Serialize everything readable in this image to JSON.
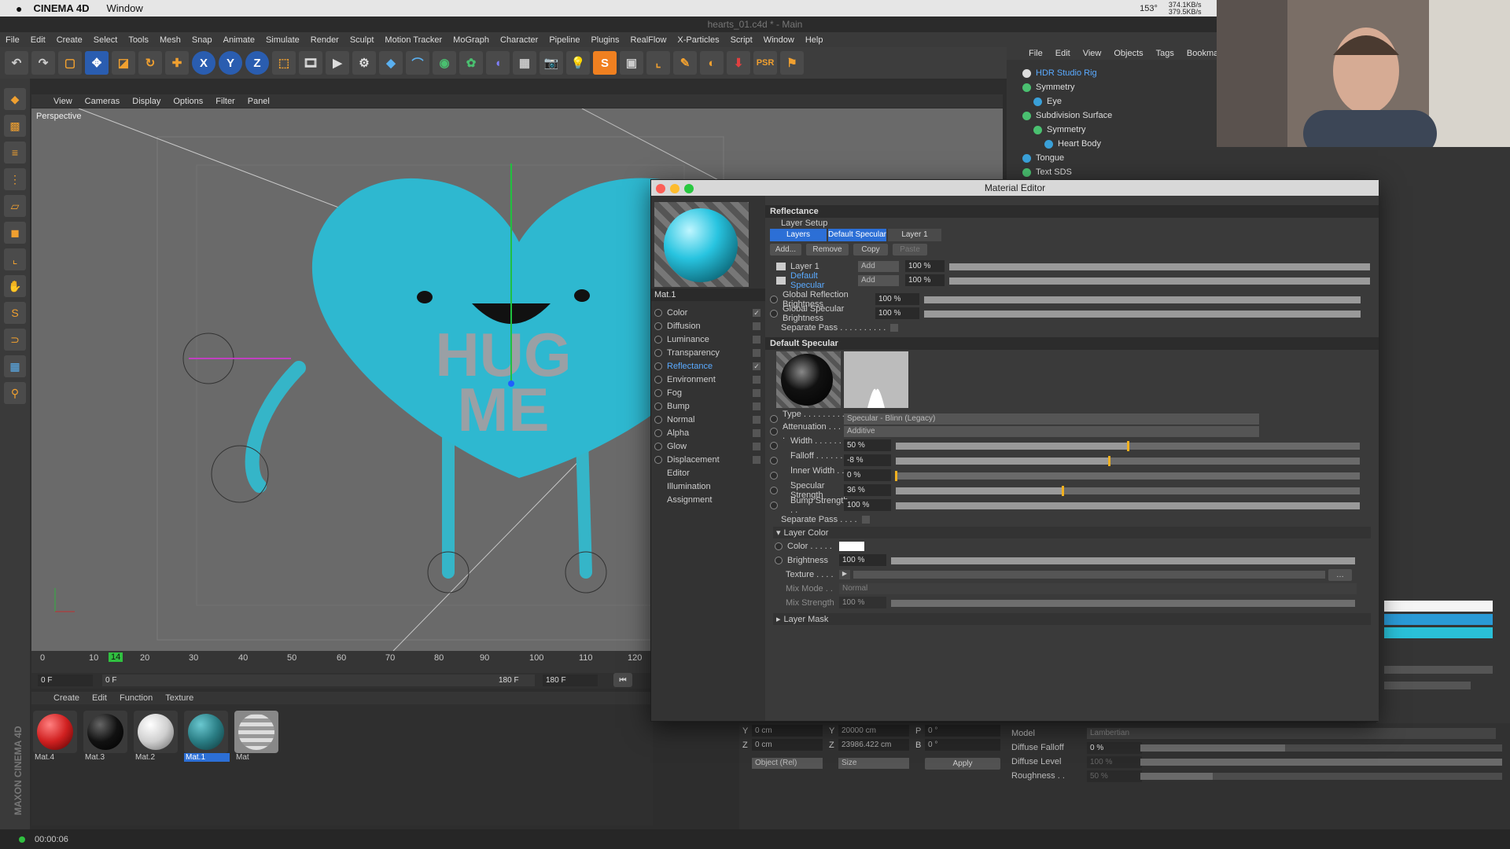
{
  "macbar": {
    "app": "CINEMA 4D",
    "menu": "Window",
    "speed": "153°",
    "net": "374.1KB/s 379.5KB/s",
    "psr": "PSR"
  },
  "window": {
    "title": "hearts_01.c4d * - Main"
  },
  "menubar": [
    "File",
    "Edit",
    "Create",
    "Select",
    "Tools",
    "Mesh",
    "Snap",
    "Animate",
    "Simulate",
    "Render",
    "Sculpt",
    "Motion Tracker",
    "MoGraph",
    "Character",
    "Pipeline",
    "Plugins",
    "RealFlow",
    "X-Particles",
    "Script",
    "Window",
    "Help"
  ],
  "viewport": {
    "menu": [
      "View",
      "Cameras",
      "Display",
      "Options",
      "Filter",
      "Panel"
    ],
    "label": "Perspective",
    "text": [
      "HUG",
      "ME"
    ]
  },
  "timeline": {
    "ticks": [
      "0",
      "10",
      "14",
      "20",
      "30",
      "40",
      "50",
      "60",
      "70",
      "80",
      "90",
      "100",
      "110",
      "120"
    ],
    "start": "0 F",
    "current": "0 F",
    "end": "180 F",
    "end2": "180 F"
  },
  "material_manager": {
    "menu": [
      "Create",
      "Edit",
      "Function",
      "Texture"
    ],
    "materials": [
      {
        "name": "Mat.4",
        "color": "#d02020"
      },
      {
        "name": "Mat.3",
        "color": "#111111"
      },
      {
        "name": "Mat.2",
        "color": "#cfcfcf"
      },
      {
        "name": "Mat.1",
        "color": "#2a7d84"
      },
      {
        "name": "Mat",
        "color": "#888888"
      }
    ]
  },
  "status": {
    "time": "00:00:06"
  },
  "object_manager": {
    "menu": [
      "File",
      "Edit",
      "View",
      "Objects",
      "Tags",
      "Bookmark"
    ],
    "items": [
      {
        "name": "HDR Studio Rig",
        "sel": true
      },
      {
        "name": "Symmetry"
      },
      {
        "name": "Eye"
      },
      {
        "name": "Subdivision Surface"
      },
      {
        "name": "Symmetry"
      },
      {
        "name": "Heart Body"
      },
      {
        "name": "Tongue"
      },
      {
        "name": "Text SDS"
      }
    ]
  },
  "material_editor": {
    "title": "Material Editor",
    "mat_name": "Mat.1",
    "channels": [
      {
        "name": "Color",
        "on": true
      },
      {
        "name": "Diffusion",
        "on": false
      },
      {
        "name": "Luminance",
        "on": false
      },
      {
        "name": "Transparency",
        "on": false
      },
      {
        "name": "Reflectance",
        "on": true,
        "sel": true
      },
      {
        "name": "Environment",
        "on": false
      },
      {
        "name": "Fog",
        "on": false
      },
      {
        "name": "Bump",
        "on": false
      },
      {
        "name": "Normal",
        "on": false
      },
      {
        "name": "Alpha",
        "on": false
      },
      {
        "name": "Glow",
        "on": false
      },
      {
        "name": "Displacement",
        "on": false
      },
      {
        "name": "Editor"
      },
      {
        "name": "Illumination"
      },
      {
        "name": "Assignment"
      }
    ],
    "reflectance": {
      "header": "Reflectance",
      "layer_setup": "Layer Setup",
      "tabs": [
        "Layers",
        "Default Specular",
        "Layer 1"
      ],
      "buttons": [
        "Add...",
        "Remove",
        "Copy",
        "Paste"
      ],
      "layers": [
        {
          "name": "Layer 1",
          "mode": "Add",
          "pct": "100 %"
        },
        {
          "name": "Default Specular",
          "mode": "Add",
          "pct": "100 %"
        }
      ],
      "global_reflection": {
        "label": "Global Reflection Brightness",
        "value": "100 %"
      },
      "global_specular": {
        "label": "Global Specular Brightness",
        "value": "100 %"
      },
      "separate_pass": "Separate Pass . . . . . . . . . ."
    },
    "default_specular": {
      "header": "Default Specular",
      "type": {
        "label": "Type . . . . . . . . . .",
        "value": "Specular - Blinn (Legacy)"
      },
      "attenuation": {
        "label": "Attenuation . . . .",
        "value": "Additive"
      },
      "params": [
        {
          "label": "Width . . . . . . . . .",
          "value": "50 %",
          "level": 0.5
        },
        {
          "label": "Falloff . . . . . . . .",
          "value": "-8 %",
          "level": 0.46
        },
        {
          "label": "Inner Width . . . .",
          "value": "0 %",
          "level": 0.0
        },
        {
          "label": "Specular Strength",
          "value": "36 %",
          "level": 0.36
        },
        {
          "label": "Bump Strength . .",
          "value": "100 %",
          "level": 1.0
        }
      ],
      "separate_pass": "Separate Pass . . . ."
    },
    "layer_color": {
      "header": "Layer Color",
      "color_label": "Color . . . . .",
      "brightness": {
        "label": "Brightness",
        "value": "100 %"
      },
      "texture_label": "Texture . . . .",
      "mix_mode": {
        "label": "Mix Mode . .",
        "value": "Normal"
      },
      "mix_strength": {
        "label": "Mix Strength",
        "value": "100 %"
      }
    },
    "layer_mask": "Layer Mask"
  },
  "coords": {
    "y1": "Y",
    "y1v": "0 cm",
    "y2": "Y",
    "y2v": "20000 cm",
    "p": "P",
    "pv": "0 °",
    "z1": "Z",
    "z1v": "0 cm",
    "z2": "Z",
    "z2v": "23986.422 cm",
    "b": "B",
    "bv": "0 °",
    "obj": "Object (Rel)",
    "size": "Size",
    "apply": "Apply"
  },
  "attributes": {
    "model": {
      "label": "Model",
      "value": "Lambertian"
    },
    "diffuse_falloff": {
      "label": "Diffuse Falloff",
      "value": "0 %"
    },
    "diffuse_level": {
      "label": "Diffuse Level",
      "value": "100 %"
    },
    "roughness": {
      "label": "Roughness . .",
      "value": "50 %"
    }
  },
  "maxon": "MAXON CINEMA 4D"
}
